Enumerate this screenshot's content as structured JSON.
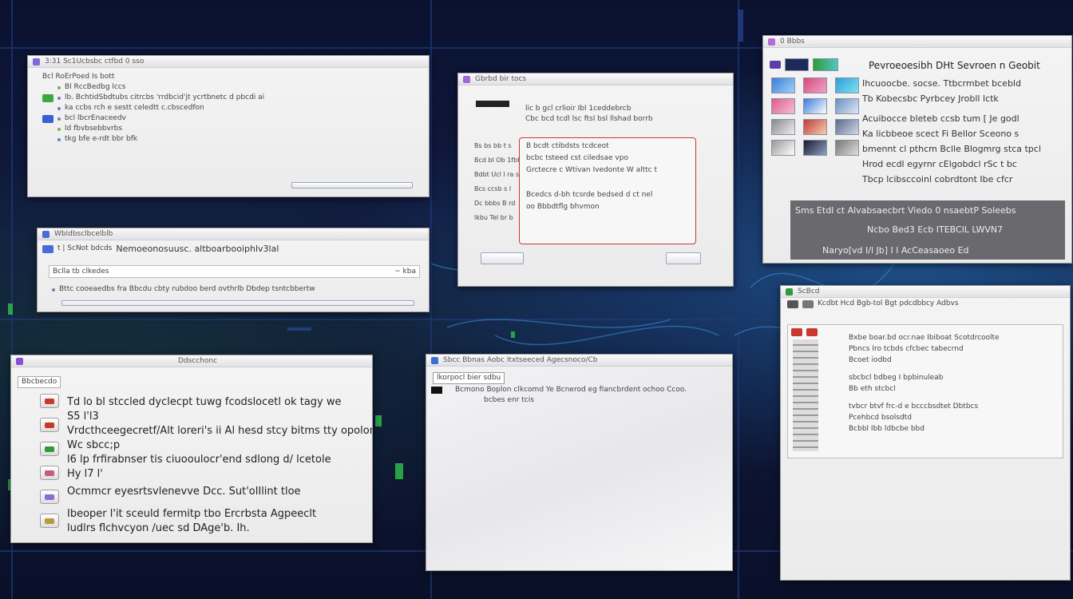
{
  "win1": {
    "title": "3:31 Sc1Ucbsbc ctfbd 0 sso",
    "header": "Bcl RoErPoed Is bott",
    "lines": [
      "Bl RccBedbg lccs",
      "lb. BchtidSbdtubs citrcbs 'rrdbcid'jt ycrtbnetc  d  pbcdi ai",
      "ka ccbs rch e sestt celedtt c.cbscedfon",
      "bcl lbcrEnaceedv",
      "ld fbvbsebbvrbs",
      "tkg bfe e-rdt bbr bfk"
    ]
  },
  "win2": {
    "title": "Wbldbsclbcelblb",
    "header_left": "t | ScNot bdcds",
    "header_right": "Nemoeonosuusc. altboarbooiphlv3lal",
    "field_label": "Bclla  tb clkedes",
    "field_value": "~ kba",
    "list_line": "Bttc cooeaedbs fra  Bbcdu cbty rubdoo berd  ovthrlb  Dbdep tsntcbbertw"
  },
  "win3": {
    "title": "Gbrbd bir tocs",
    "lines": [
      "lic b gcl crlioir Ibl 1ceddebrcb",
      "Cbc bcd tcdl lsc ftsl bsl llshad borrb",
      "B bcdt ctibdsts tcdceot",
      "bcbc tsteed cst ciledsae vpo",
      "Grctecre c  Wtivan Ivedonte  W alttc  t",
      "Bcedcs d-bh tcsrde  bedsed d ct nel",
      "oo Bbbdtflg bhvmon"
    ],
    "left_labels": [
      "Bs bs bb  t s",
      "Bcd bl Ob 1fbt",
      "Bdbt Ucl l ra s",
      "Bcs ccsb  s  l",
      "Dc bbbs B rd",
      "lkbu Tel br b"
    ]
  },
  "win4": {
    "title": "0 Bbbs",
    "header": "Pevroeoesibh DHt  Sevroen n  Geobit",
    "lines": [
      "Ihcuoocbe. socse.  Ttbcrmbet  bcebld",
      "Tb Kobecsbc Pyrbcey Jrobll lctk",
      "Acuibocce bleteb  ccsb  tum  [ Je  godl",
      "Ka licbbeoe scect Fi  Bellor  Sceono s",
      "bmennt cl pthcm Bclle Blogmrg  stca  tpcl",
      "Hrod ecdl egyrnr  cElgobdcl rSc t  bc",
      "Tbcp lcibsccoinl cobrdtont Ibe cfcr"
    ],
    "bar_line1": "Sms  Etdl ct  Alvabsaecbrt   Viedo  0  nsaebtP Soleebs",
    "bar_line2": "Ncbo  Bed3 Ecb  ITEBClL  LWVN7",
    "bar_line3": "Naryo[vd I/l     Jb] I l  AcCeasaoeo Ed"
  },
  "win5": {
    "title": "Ddscchonc",
    "rows": [
      "Td lo bl stccled  dyclecpt tuwg  fcodslocetl ok tagy we",
      "S5 l'l3",
      "Vrdcthceegecretf/Alt loreri's ii Al  hesd stcy bitms tty opolon",
      "Wc sbcc;p",
      "l6 lp frfirabnser tis ciuooulocr'end sdlong  d/ lcetole",
      "Hy l7 l'",
      "Ocmmcr eyesrtsvlenevve  Dcc.  Sut'olIlint tloe",
      "Ibeoper  l'it  sceuld fermitp tbo Ercrbsta Agpeeclt",
      "ludlrs flchvcyon /uec sd DAge'b.  Ih."
    ],
    "tag_label": "Bbcbecdo"
  },
  "win6": {
    "title": "Sbcc  Bbnas Aobc Itxtseeced  Agecsnoco/Cb",
    "tab": "lkorpocl  bier  sdbu",
    "line1": "Bcmono  Boplon  clkcomd  Ye  Bcnerod  eg  fiancbrdent  ochoo  Ccoo.",
    "line2": "bcbes  enr tcis"
  },
  "win7": {
    "title": "ScBcd",
    "toolbar": "Kcdbt  Hcd Bgb-tol  Bgt pdcdbbcy Adbvs",
    "lines": [
      "Bxbe boar.bd ocr.nae  Ibiboat Scotdrcoolte",
      "Pbncs Iro  tcbds cfcbec tabecrnd",
      "Bcoet iodbd",
      "sbcbcl bdbeg  I bpbinuleab",
      "Bb eth stcbcl",
      "tvbcr btvf frc-d  e bcccbsdtet  Dbtbcs",
      "Pcehbcd bsolsdtd",
      "Bcbbl  Ibb  ldbcbe bbd"
    ]
  },
  "colors": {
    "window_bg": "#f0f0f1",
    "title_gradient_top": "#fafafa",
    "accent_blue": "#3b6fd0",
    "accent_red": "#c7382e",
    "accent_green": "#2f9a3a",
    "background": "#0b1230"
  }
}
